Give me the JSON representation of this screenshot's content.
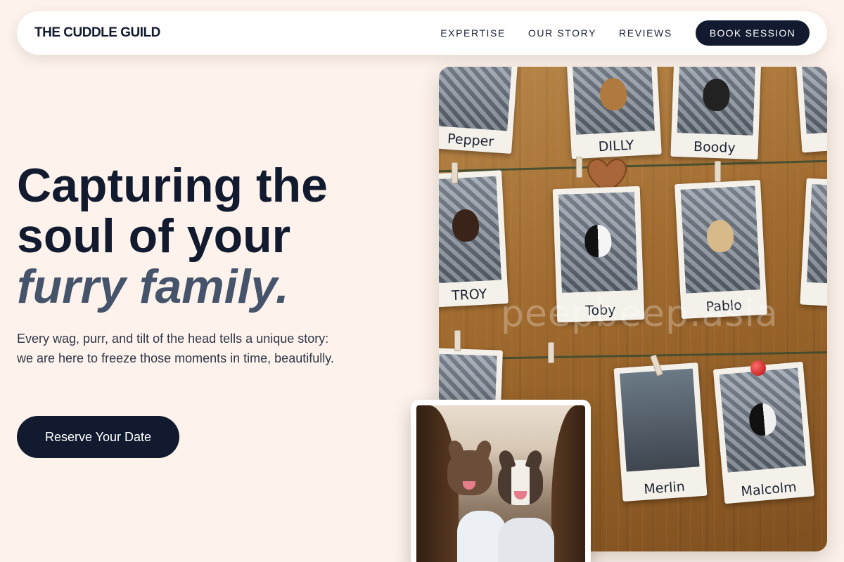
{
  "brand": {
    "name": "THE CUDDLE GUILD"
  },
  "nav": {
    "links": [
      "EXPERTISE",
      "OUR STORY",
      "REVIEWS"
    ],
    "cta": "BOOK SESSION"
  },
  "hero": {
    "title_line1": "Capturing the",
    "title_line2": "soul of your",
    "title_accent": "furry family.",
    "subtitle": "Every wag, purr, and tilt of the head tells a unique story: we are here to freeze those moments in time, beautifully.",
    "cta": "Reserve Your Date"
  },
  "photo_main": {
    "watermark": "peepbeep.asia",
    "polaroid_names": [
      "Pepper",
      "DILLY",
      "Boody",
      "TROY",
      "Toby",
      "Pablo",
      "Merlin",
      "Malcolm"
    ]
  },
  "colors": {
    "background": "#fdf3ec",
    "navy": "#111a2e",
    "accent_slate": "#45536b"
  }
}
